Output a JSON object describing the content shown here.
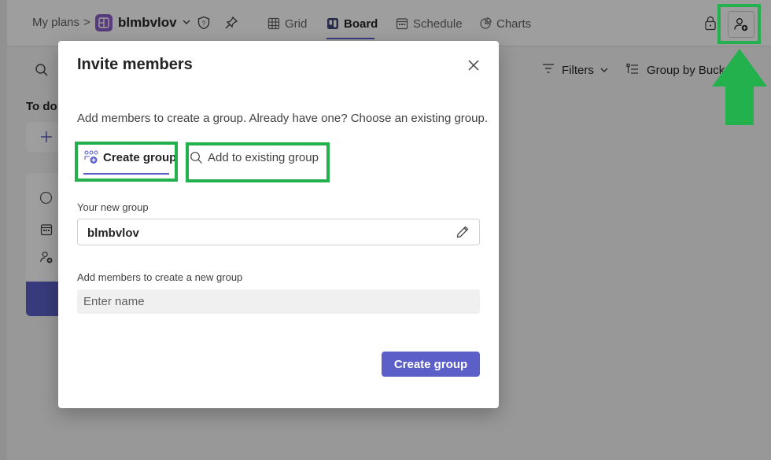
{
  "header": {
    "breadcrumb_root": "My plans",
    "breadcrumb_sep": ">",
    "plan_name": "blmbvlov",
    "views": [
      {
        "label": "Grid",
        "icon": "grid-icon"
      },
      {
        "label": "Board",
        "icon": "board-icon",
        "active": true
      },
      {
        "label": "Schedule",
        "icon": "schedule-icon"
      },
      {
        "label": "Charts",
        "icon": "charts-icon"
      }
    ]
  },
  "toolbar": {
    "filters_label": "Filters",
    "group_by_label": "Group by Bucke"
  },
  "board": {
    "bucket_title": "To do"
  },
  "dialog": {
    "title": "Invite members",
    "description": "Add members to create a group. Already have one? Choose an existing group.",
    "tabs": [
      {
        "label": "Create group",
        "icon": "create-group-icon",
        "active": true
      },
      {
        "label": "Add to existing group",
        "icon": "search-icon",
        "active": false
      }
    ],
    "group_name_label": "Your new group",
    "group_name_value": "blmbvlov",
    "members_label": "Add members to create a new group",
    "members_placeholder": "Enter name",
    "primary_button": "Create group"
  },
  "colors": {
    "accent": "#5b5fc7",
    "plan_tile": "#8f5fc9",
    "highlight": "#22b14c"
  }
}
